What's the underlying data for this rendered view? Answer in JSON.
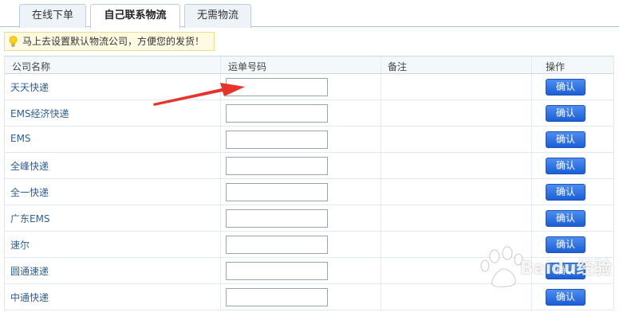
{
  "tabs": [
    {
      "label": "在线下单",
      "active": false
    },
    {
      "label": "自己联系物流",
      "active": true
    },
    {
      "label": "无需物流",
      "active": false
    }
  ],
  "tip": {
    "text": "马上去设置默认物流公司，方便您的发货！",
    "icon": "lightbulb-icon"
  },
  "table": {
    "headers": {
      "company": "公司名称",
      "tracking": "运单号码",
      "remark": "备注",
      "action": "操作"
    },
    "button_label": "确认",
    "rows": [
      {
        "company": "天天快递",
        "tracking": ""
      },
      {
        "company": "EMS经济快递",
        "tracking": ""
      },
      {
        "company": "EMS",
        "tracking": ""
      },
      {
        "company": "全峰快递",
        "tracking": ""
      },
      {
        "company": "全一快递",
        "tracking": ""
      },
      {
        "company": "广东EMS",
        "tracking": ""
      },
      {
        "company": "速尔",
        "tracking": ""
      },
      {
        "company": "圆通速递",
        "tracking": ""
      },
      {
        "company": "中通快递",
        "tracking": ""
      }
    ]
  },
  "watermark": {
    "text": "Baidu经验"
  },
  "colors": {
    "link": "#2d5f9a",
    "button": "#1b5fd6",
    "tip_bg": "#fffbe3",
    "arrow": "#e8332a"
  }
}
